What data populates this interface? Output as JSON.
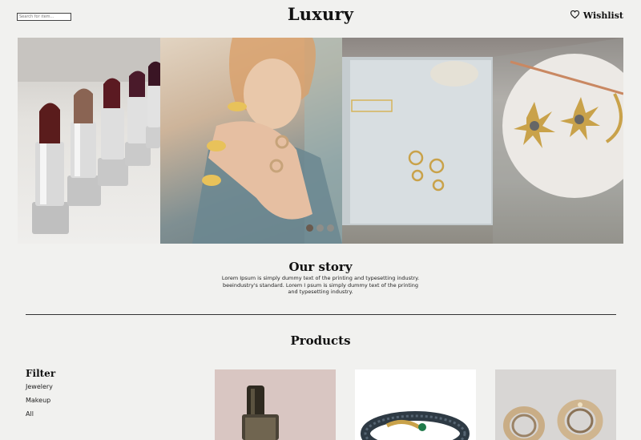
{
  "header": {
    "search_placeholder": "Search for item...",
    "brand": "Luxury",
    "wishlist_label": "Wishlist"
  },
  "hero": {
    "carousel_dots": 3,
    "active_dot": 1
  },
  "story": {
    "title": "Our story",
    "text": "Lorem Ipsum is simply dummy text of the printing and typesetting industry. beeindustry's standard. Lorem I psum is simply dummy text of the printing and typesetting industry."
  },
  "products": {
    "title": "Products"
  },
  "filter": {
    "title": "Filter",
    "items": [
      "Jewelery",
      "Makeup",
      "All"
    ]
  },
  "colors": {
    "background": "#f1f1ef",
    "text": "#111111",
    "divider": "#333333"
  }
}
